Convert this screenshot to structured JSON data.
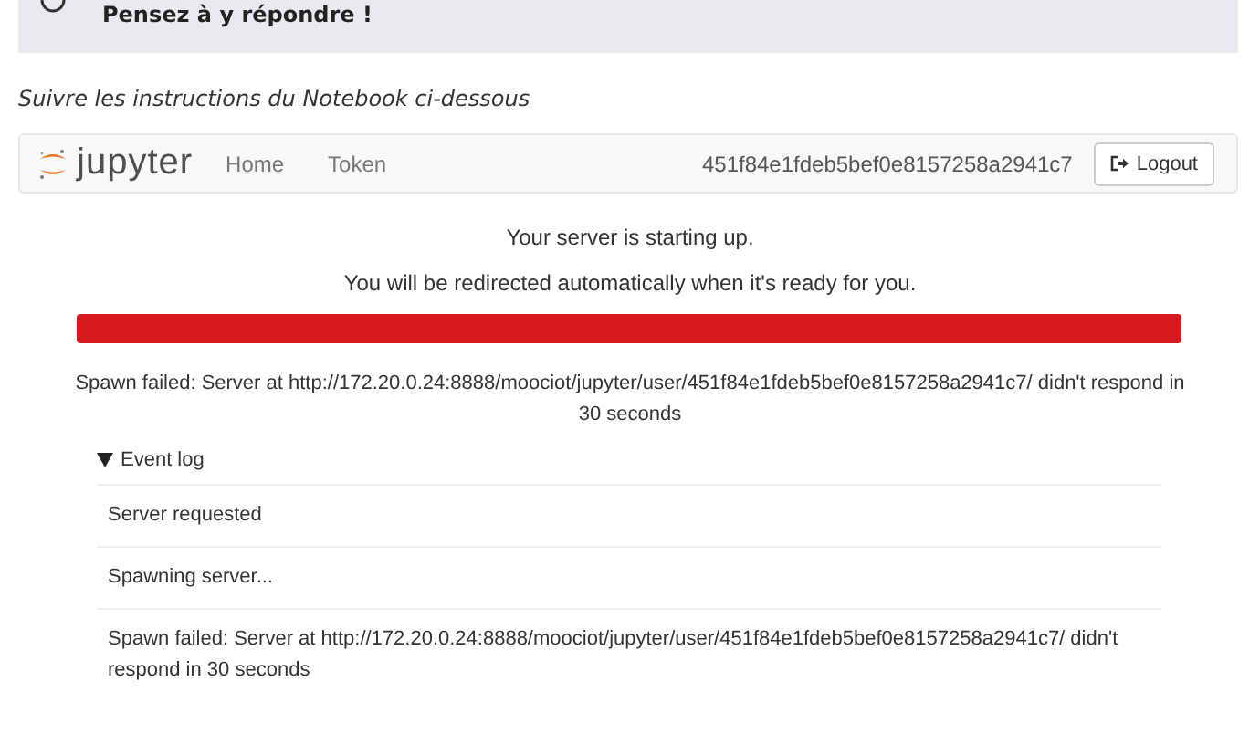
{
  "banner": {
    "text": "Pensez à y répondre !"
  },
  "instructions": "Suivre les instructions du Notebook ci-dessous",
  "navbar": {
    "logo": "jupyter",
    "links": [
      {
        "label": "Home"
      },
      {
        "label": "Token"
      }
    ],
    "user": "451f84e1fdeb5bef0e8157258a2941c7",
    "logout": "Logout"
  },
  "status": {
    "heading": "Your server is starting up.",
    "subheading": "You will be redirected automatically when it's ready for you.",
    "progress": {
      "level": 1,
      "failed": true
    },
    "message": "Spawn failed: Server at http://172.20.0.24:8888/moociot/jupyter/user/451f84e1fdeb5bef0e8157258a2941c7/ didn't respond in 30 seconds"
  },
  "event_log": {
    "label": "Event log",
    "expanded": true,
    "events": [
      {
        "text": "Server requested"
      },
      {
        "text": "Spawning server..."
      },
      {
        "text": "Spawn failed: Server at http://172.20.0.24:8888/moociot/jupyter/user/451f84e1fdeb5bef0e8157258a2941c7/ didn't respond in 30 seconds"
      }
    ]
  }
}
